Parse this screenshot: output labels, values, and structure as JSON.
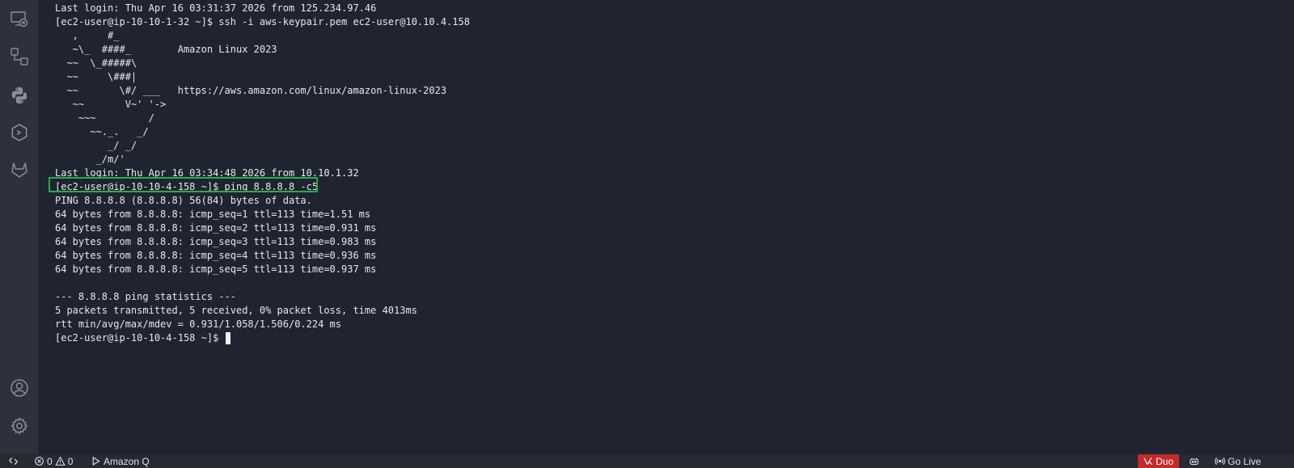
{
  "activity_bar": {
    "icons": [
      {
        "name": "remote-explorer-icon"
      },
      {
        "name": "source-control-icon"
      },
      {
        "name": "python-icon"
      },
      {
        "name": "extension-hexagon-icon"
      },
      {
        "name": "gitlab-icon"
      },
      {
        "name": "account-icon"
      },
      {
        "name": "settings-gear-icon"
      }
    ]
  },
  "terminal": {
    "lines": [
      "Last login: Thu Apr 16 03:31:37 2026 from 125.234.97.46",
      "[ec2-user@ip-10-10-1-32 ~]$ ssh -i aws-keypair.pem ec2-user@10.10.4.158",
      "   ,     #_",
      "   ~\\_  ####_        Amazon Linux 2023",
      "  ~~  \\_#####\\",
      "  ~~     \\###|",
      "  ~~       \\#/ ___   https://aws.amazon.com/linux/amazon-linux-2023",
      "   ~~       V~' '->",
      "    ~~~         /",
      "      ~~._.   _/",
      "         _/ _/",
      "       _/m/'",
      "Last login: Thu Apr 16 03:34:48 2026 from 10.10.1.32",
      "[ec2-user@ip-10-10-4-158 ~]$ ping 8.8.8.8 -c5",
      "PING 8.8.8.8 (8.8.8.8) 56(84) bytes of data.",
      "64 bytes from 8.8.8.8: icmp_seq=1 ttl=113 time=1.51 ms",
      "64 bytes from 8.8.8.8: icmp_seq=2 ttl=113 time=0.931 ms",
      "64 bytes from 8.8.8.8: icmp_seq=3 ttl=113 time=0.983 ms",
      "64 bytes from 8.8.8.8: icmp_seq=4 ttl=113 time=0.936 ms",
      "64 bytes from 8.8.8.8: icmp_seq=5 ttl=113 time=0.937 ms",
      "",
      "--- 8.8.8.8 ping statistics ---",
      "5 packets transmitted, 5 received, 0% packet loss, time 4013ms",
      "rtt min/avg/max/mdev = 0.931/1.058/1.506/0.224 ms"
    ],
    "prompt": "[ec2-user@ip-10-10-4-158 ~]$ ",
    "highlight_color": "#22b14c"
  },
  "status_bar": {
    "remote_icon": "remote-icon",
    "errors": "0",
    "warnings": "0",
    "amazon_q_label": "Amazon Q",
    "duo_label": "Duo",
    "go_live_label": "Go Live",
    "duo_color": "#c02b2b"
  }
}
